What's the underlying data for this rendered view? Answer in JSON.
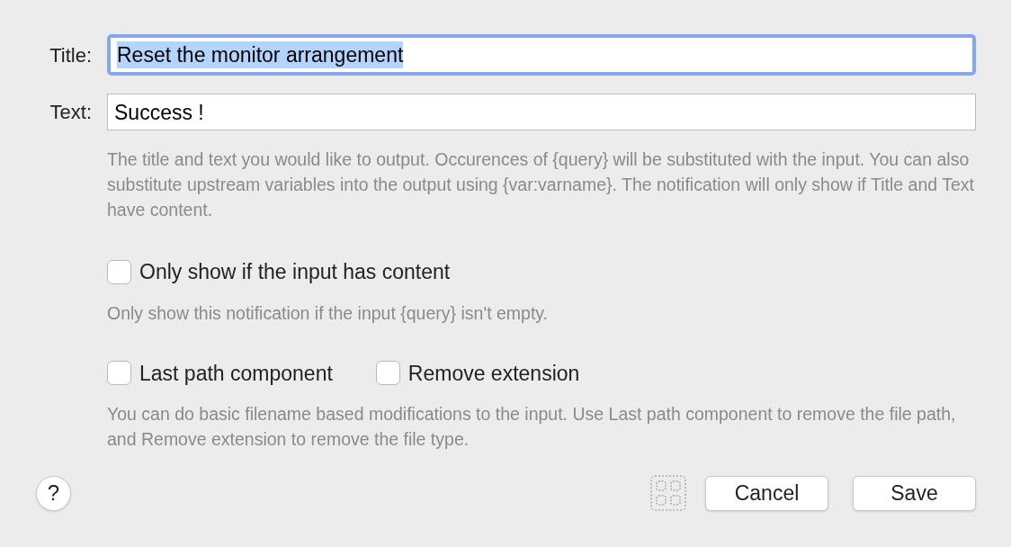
{
  "fields": [
    {
      "label": "Title:",
      "value": "Reset the monitor arrangement",
      "focused": true,
      "selected_text": true
    },
    {
      "label": "Text:",
      "value": "Success !",
      "focused": false,
      "selected_text": false
    }
  ],
  "fields_help": "The title and text you would like to output. Occurences of {query} will be substituted with the input. You can also substitute upstream variables into the output using {var:varname}. The notification will only show if Title and Text have content.",
  "options": [
    {
      "checkboxes": [
        {
          "label": "Only show if the input has content",
          "checked": false
        }
      ],
      "help": "Only show this notification if the input {query} isn't empty."
    },
    {
      "checkboxes": [
        {
          "label": "Last path component",
          "checked": false
        },
        {
          "label": "Remove extension",
          "checked": false
        }
      ],
      "help": "You can do basic filename based modifications to the input. Use Last path component to remove the file path, and Remove extension to remove the file type."
    }
  ],
  "help_button": "?",
  "buttons": [
    "Cancel",
    "Save"
  ]
}
